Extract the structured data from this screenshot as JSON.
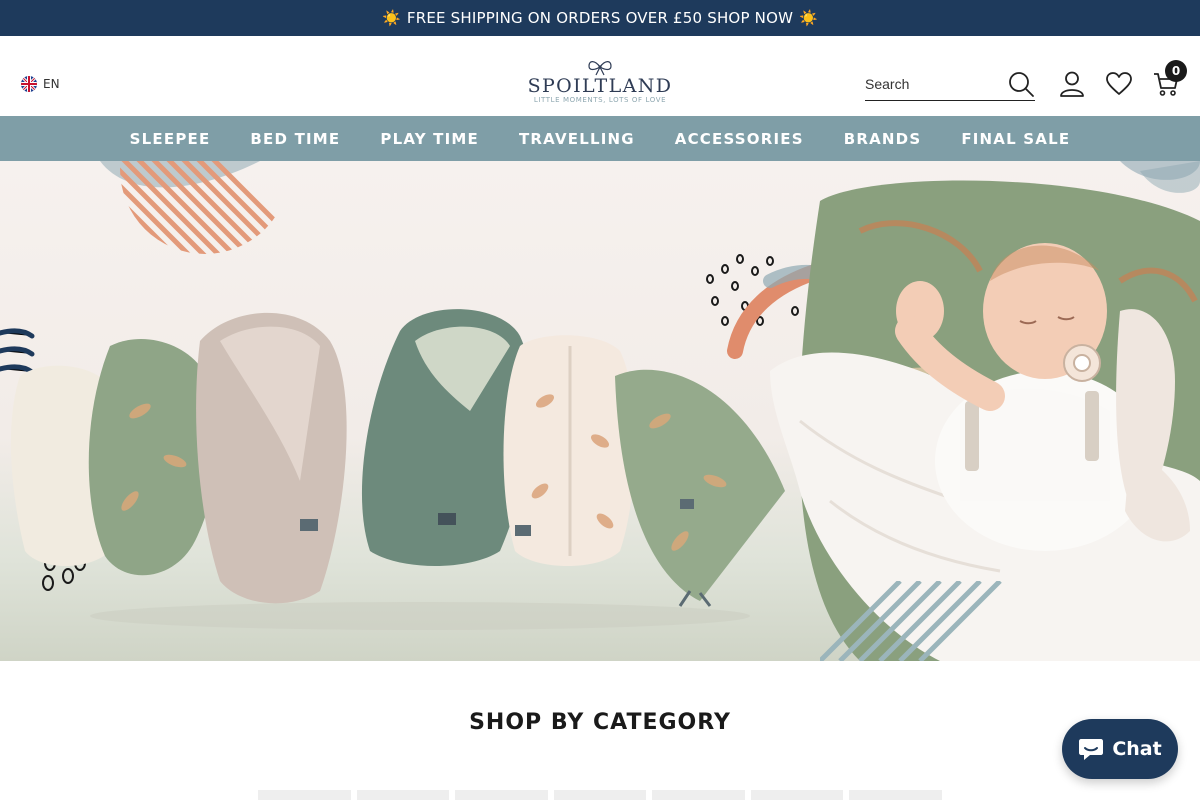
{
  "announcement": {
    "text": "FREE SHIPPING ON ORDERS OVER £50 SHOP NOW",
    "left_emoji": "☀️",
    "right_emoji": "☀️"
  },
  "header": {
    "language": "EN",
    "logo": {
      "brand": "SPOILTLAND",
      "tagline": "LITTLE MOMENTS, LOTS OF LOVE"
    },
    "search": {
      "placeholder": "Search"
    },
    "cart_count": "0",
    "icons": [
      "search-icon",
      "account-icon",
      "wishlist-icon",
      "cart-icon"
    ]
  },
  "nav": {
    "items": [
      "SLEEPEE",
      "BED TIME",
      "PLAY TIME",
      "TRAVELLING",
      "ACCESSORIES",
      "BRANDS",
      "FINAL SALE"
    ]
  },
  "main": {
    "section_title": "SHOP BY CATEGORY"
  },
  "chat": {
    "label": "Chat"
  },
  "colors": {
    "announcement_bg": "#1e3a5c",
    "nav_bg": "#7f9ea7",
    "chat_bg": "#1e3a5c",
    "sage": "#7e9a7d",
    "terracotta": "#e08c6c"
  }
}
